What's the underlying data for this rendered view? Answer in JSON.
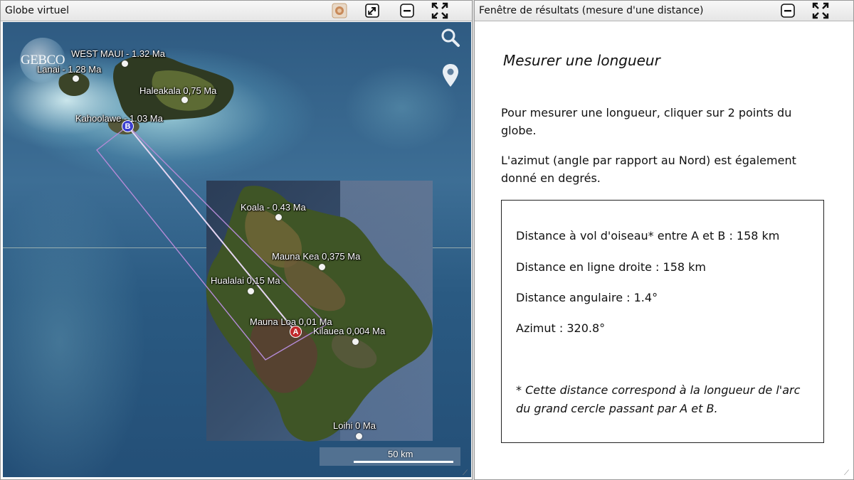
{
  "left_window": {
    "title": "Globe virtuel",
    "buttons": {
      "settings": "settings-icon",
      "detach": "detach-icon",
      "minimize": "minimize-icon",
      "fullscreen": "fullscreen-icon"
    },
    "map": {
      "logo": "GEBCO",
      "places": [
        {
          "name": "WEST MAUI - 1.32 Ma"
        },
        {
          "name": "Lanai - 1.28 Ma"
        },
        {
          "name": "Haleakala 0,75 Ma"
        },
        {
          "name": "Kahoolawe - 1.03 Ma"
        },
        {
          "name": "Koala - 0.43 Ma"
        },
        {
          "name": "Mauna Kea 0,375 Ma"
        },
        {
          "name": "Hualalai 0,15 Ma"
        },
        {
          "name": "Mauna Loa 0,01 Ma"
        },
        {
          "name": "Kilauea 0,004 Ma"
        },
        {
          "name": "Loihi 0 Ma"
        }
      ],
      "marker_a": "A",
      "marker_b": "B",
      "scale_label": "50 km",
      "tools": {
        "search": "search-icon",
        "place": "map-pin-icon"
      }
    }
  },
  "right_window": {
    "title": "Fenêtre de résultats (mesure d'une distance)",
    "heading": "Mesurer une longueur",
    "paragraph_1": "Pour mesurer une longueur, cliquer sur 2 points du globe.",
    "paragraph_2": "L'azimut (angle par rapport au Nord) est également donné en degrés.",
    "results": {
      "bird_distance": "Distance à vol d'oiseau* entre A et B : 158 km",
      "straight_distance": "Distance en ligne droite : 158 km",
      "angular_distance": "Distance angulaire : 1.4°",
      "azimuth": "Azimut : 320.8°",
      "note": "* Cette distance correspond à la longueur de l'arc du grand cercle passant par A et B."
    }
  },
  "colors": {
    "ocean": "#2f5b82",
    "marker_a": "#c0282a",
    "marker_b": "#3b3fd0",
    "measure_line": "#e6d6f2"
  }
}
